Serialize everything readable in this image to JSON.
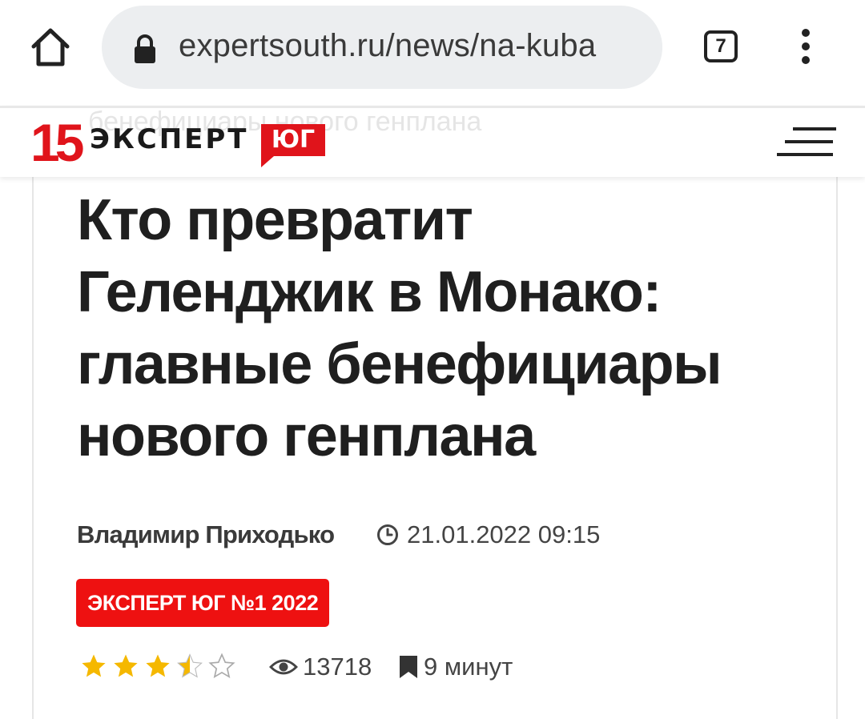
{
  "browser": {
    "url": "expertsouth.ru/news/na-kuba",
    "tab_count": "7",
    "icons": {
      "home": "home-icon",
      "lock": "lock-icon",
      "tabs": "tabs-icon",
      "menu": "more-vert-icon"
    }
  },
  "site": {
    "logo_number": "15",
    "logo_name": "ЭКСПЕРТ",
    "logo_region": "ЮГ",
    "ghost_title": "бенефициары нового генплана",
    "brand_color": "#e0141b"
  },
  "article": {
    "headline_lines": [
      "Кто превратит",
      "Геленджик в Монако:",
      "главные бенефициары",
      "нового генплана"
    ],
    "author": "Владимир Приходько",
    "date": "21.01.2022 09:15",
    "issue_badge": "ЭКСПЕРТ ЮГ №1 2022",
    "rating": 3.5,
    "rating_max": 5,
    "views": "13718",
    "read_time": "9 минут",
    "badge_color": "#ee1111",
    "star_color": "#f5b800"
  }
}
